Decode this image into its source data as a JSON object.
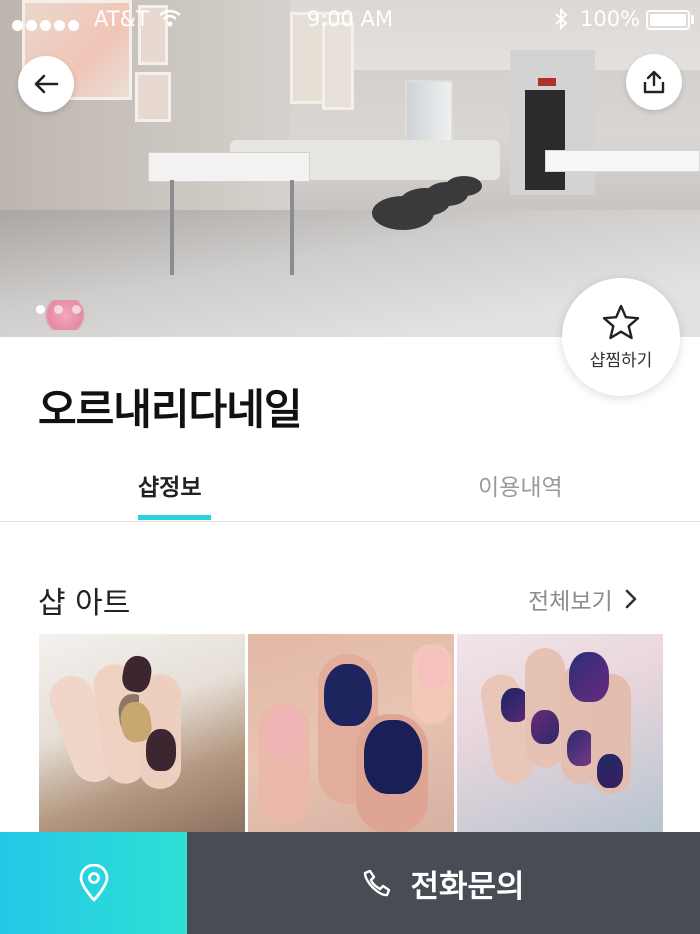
{
  "status_bar": {
    "carrier": "AT&T",
    "time": "9:00 AM",
    "battery": "100%"
  },
  "hero": {
    "pager_count": 3,
    "pager_active": 0
  },
  "actions": {
    "favorite_label": "샵찜하기"
  },
  "shop": {
    "name": "오르내리다네일"
  },
  "tabs": [
    {
      "label": "샵정보",
      "active": true
    },
    {
      "label": "이용내역",
      "active": false
    }
  ],
  "section": {
    "title": "샵 아트",
    "see_all": "전체보기"
  },
  "bottom_bar": {
    "call_label": "전화문의"
  },
  "colors": {
    "accent": "#27d2d8",
    "call_bg": "#474c55"
  }
}
